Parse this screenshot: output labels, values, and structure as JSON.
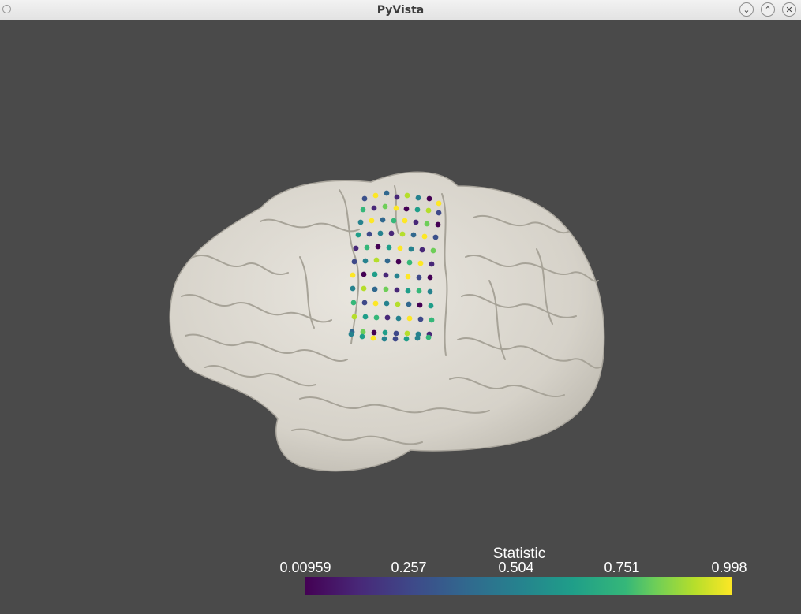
{
  "window": {
    "title": "PyVista",
    "minimize_glyph": "⌄",
    "maximize_glyph": "⌃",
    "close_glyph": "✕"
  },
  "scene": {
    "background_color": "#4a4a4a",
    "surface_color": "#d9d6ce",
    "object": "brain-surface",
    "markers": "electrode-spheres"
  },
  "colorbar": {
    "title": "Statistic",
    "colormap": "viridis",
    "ticks": [
      "0.00959",
      "0.257",
      "0.504",
      "0.751",
      "0.998"
    ]
  }
}
